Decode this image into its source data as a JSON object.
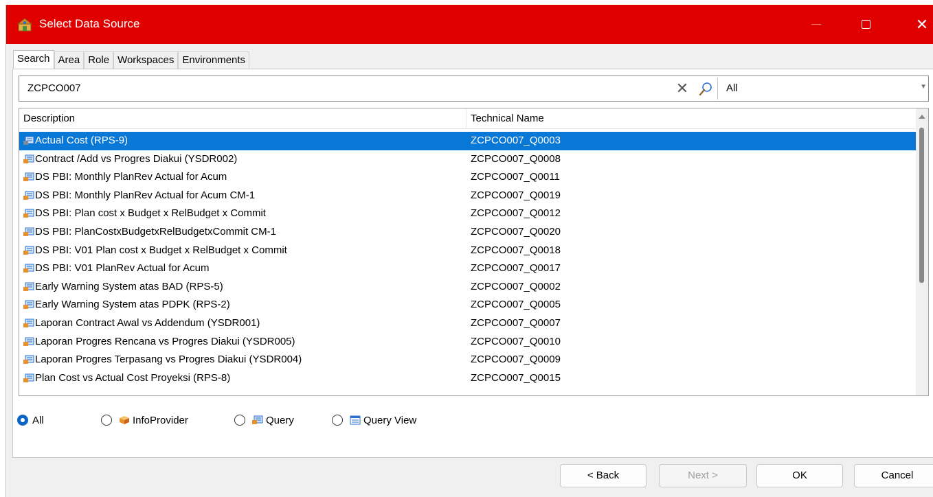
{
  "window": {
    "title": "Select Data Source",
    "close_glyph": "✕"
  },
  "tabs": [
    {
      "label": "Search",
      "active": true
    },
    {
      "label": "Area"
    },
    {
      "label": "Role"
    },
    {
      "label": "Workspaces"
    },
    {
      "label": "Environments"
    }
  ],
  "search": {
    "value": "ZCPCO007",
    "clear_glyph": "✕",
    "filter_value": "All",
    "filter_arrow": "▼"
  },
  "list": {
    "columns": {
      "description": "Description",
      "technical_name": "Technical Name"
    },
    "rows": [
      {
        "description": "Actual Cost (RPS-9)",
        "technical_name": "ZCPCO007_Q0003",
        "selected": true
      },
      {
        "description": "Contract /Add vs Progres Diakui (YSDR002)",
        "technical_name": "ZCPCO007_Q0008"
      },
      {
        "description": "DS PBI: Monthly PlanRev Actual for Acum",
        "technical_name": "ZCPCO007_Q0011"
      },
      {
        "description": "DS PBI: Monthly PlanRev Actual for Acum CM-1",
        "technical_name": "ZCPCO007_Q0019"
      },
      {
        "description": "DS PBI: Plan cost x Budget x RelBudget x Commit",
        "technical_name": "ZCPCO007_Q0012"
      },
      {
        "description": "DS PBI: PlanCostxBudgetxRelBudgetxCommit CM-1",
        "technical_name": "ZCPCO007_Q0020"
      },
      {
        "description": "DS PBI: V01 Plan cost x Budget x RelBudget x Commit",
        "technical_name": "ZCPCO007_Q0018"
      },
      {
        "description": "DS PBI: V01 PlanRev Actual for Acum",
        "technical_name": "ZCPCO007_Q0017"
      },
      {
        "description": "Early Warning System atas BAD (RPS-5)",
        "technical_name": "ZCPCO007_Q0002"
      },
      {
        "description": "Early Warning System atas PDPK (RPS-2)",
        "technical_name": "ZCPCO007_Q0005"
      },
      {
        "description": "Laporan Contract Awal vs Addendum (YSDR001)",
        "technical_name": "ZCPCO007_Q0007"
      },
      {
        "description": "Laporan Progres Rencana vs Progres Diakui (YSDR005)",
        "technical_name": "ZCPCO007_Q0010"
      },
      {
        "description": "Laporan Progres Terpasang vs Progres Diakui (YSDR004)",
        "technical_name": "ZCPCO007_Q0009"
      },
      {
        "description": "Plan Cost vs Actual Cost Proyeksi (RPS-8)",
        "technical_name": "ZCPCO007_Q0015"
      }
    ]
  },
  "type_filter": [
    {
      "label": "All",
      "selected": true,
      "icon": ""
    },
    {
      "label": "InfoProvider",
      "icon": "cube-icon"
    },
    {
      "label": "Query",
      "icon": "query-icon"
    },
    {
      "label": "Query View",
      "icon": "query-view-icon"
    }
  ],
  "buttons": {
    "back": "< Back",
    "next": "Next >",
    "ok": "OK",
    "cancel": "Cancel"
  },
  "colors": {
    "titlebar": "#e00000",
    "selection": "#0a78d7"
  }
}
